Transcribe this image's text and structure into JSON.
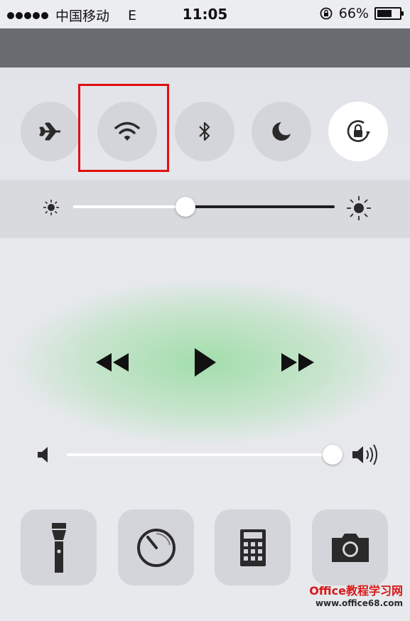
{
  "status_bar": {
    "carrier": "中国移动",
    "network": "E",
    "time": "11:05",
    "battery_percent": "66%",
    "battery_level": 0.66
  },
  "control_center": {
    "toggles": [
      {
        "name": "airplane-mode",
        "icon": "airplane-icon",
        "active": false
      },
      {
        "name": "wifi",
        "icon": "wifi-icon",
        "active": false,
        "highlighted": true
      },
      {
        "name": "bluetooth",
        "icon": "bluetooth-icon",
        "active": false
      },
      {
        "name": "do-not-disturb",
        "icon": "moon-icon",
        "active": false
      },
      {
        "name": "rotation-lock",
        "icon": "rotation-lock-icon",
        "active": true
      }
    ],
    "brightness": {
      "level": 0.43
    },
    "media": {
      "controls": [
        "previous-track-icon",
        "play-icon",
        "next-track-icon"
      ]
    },
    "volume": {
      "level": 1.0
    },
    "shortcuts": [
      "flashlight-icon",
      "timer-icon",
      "calculator-icon",
      "camera-icon"
    ]
  },
  "watermark": {
    "brand": "Office教程学习网",
    "url": "www.office68.com"
  },
  "colors": {
    "highlight": "#e01010",
    "toggle_inactive": "#d4d5da",
    "toggle_active": "#ffffff",
    "glow": "#9ddca6"
  }
}
